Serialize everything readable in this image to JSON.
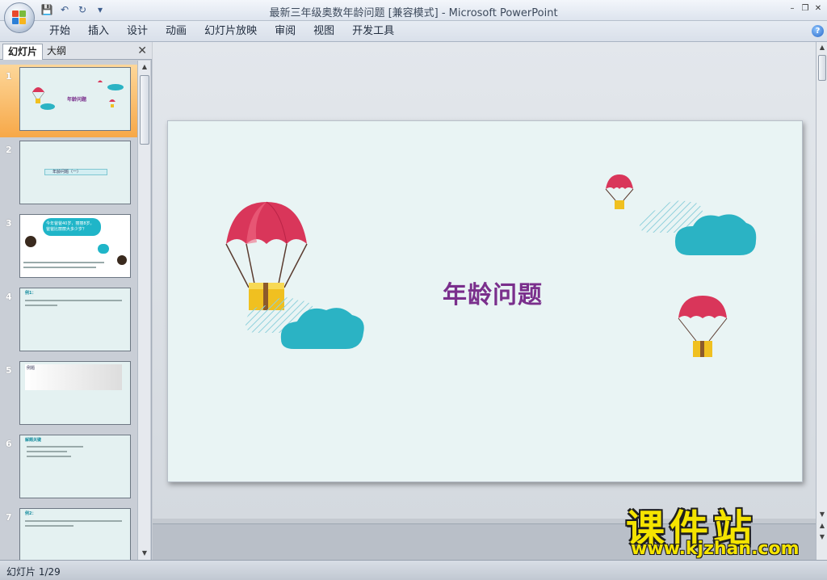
{
  "window": {
    "title": "最新三年级奥数年龄问题 [兼容模式] - Microsoft PowerPoint"
  },
  "ribbon": {
    "tabs": [
      "开始",
      "插入",
      "设计",
      "动画",
      "幻灯片放映",
      "审阅",
      "视图",
      "开发工具"
    ]
  },
  "left_pane": {
    "tab_slides": "幻灯片",
    "tab_outline": "大纲",
    "thumbnails": [
      {
        "num": "1",
        "text": "年龄问题"
      },
      {
        "num": "2",
        "text": "年龄问题（一）"
      },
      {
        "num": "3",
        "text": "今年爸爸40岁，丽丽8岁。爸爸比丽丽大多少岁？"
      },
      {
        "num": "4",
        "text": "例1："
      },
      {
        "num": "5",
        "text": "例题"
      },
      {
        "num": "6",
        "text": "解题关键"
      },
      {
        "num": "7",
        "text": "例2："
      }
    ]
  },
  "slide": {
    "title": "年龄问题"
  },
  "statusbar": {
    "slide_info": "幻灯片 1/29"
  },
  "watermark": {
    "title": "课件站",
    "url": "www.kjzhan.com"
  },
  "colors": {
    "slide_bg": "#e9f4f4",
    "title_color": "#7a2f8c",
    "cloud": "#2bb3c4",
    "parachute": "#d9365a",
    "box": "#f0c020"
  }
}
